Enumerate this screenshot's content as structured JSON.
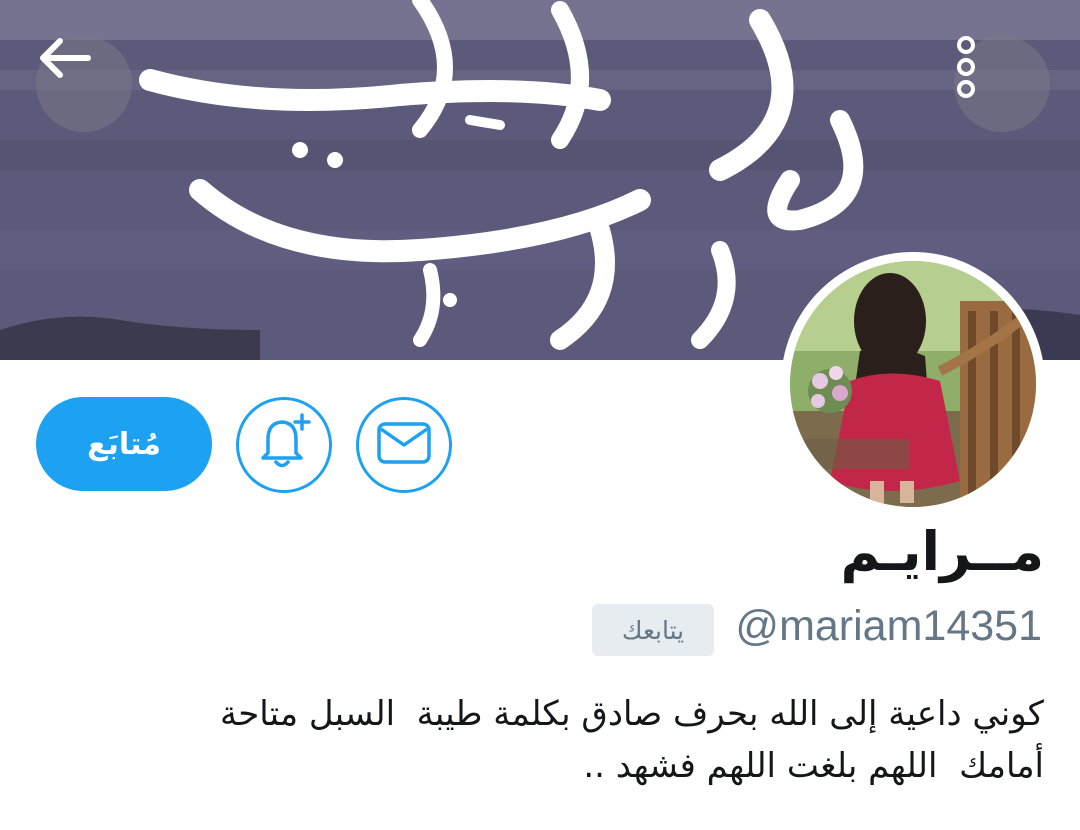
{
  "profile": {
    "display_name": "مــرايـم",
    "handle": "@mariam14351",
    "follows_you_badge": "يتابعك",
    "bio_lines": [
      "كوني داعية إلى الله بحرف صادق بكلمة طيبة  السبل متاحة",
      "أمامك  اللهم بلغت اللهم فشهد .."
    ]
  },
  "actions": {
    "follow_label": "مُتابَع"
  },
  "icons": {
    "back": "back-arrow-icon",
    "more": "more-vertical-icon",
    "notify": "bell-plus-icon",
    "message": "envelope-icon"
  },
  "colors": {
    "accent": "#1da1f2",
    "secondary_text": "#657786",
    "badge_bg": "#e6ecf0",
    "primary_text": "#14171a"
  }
}
